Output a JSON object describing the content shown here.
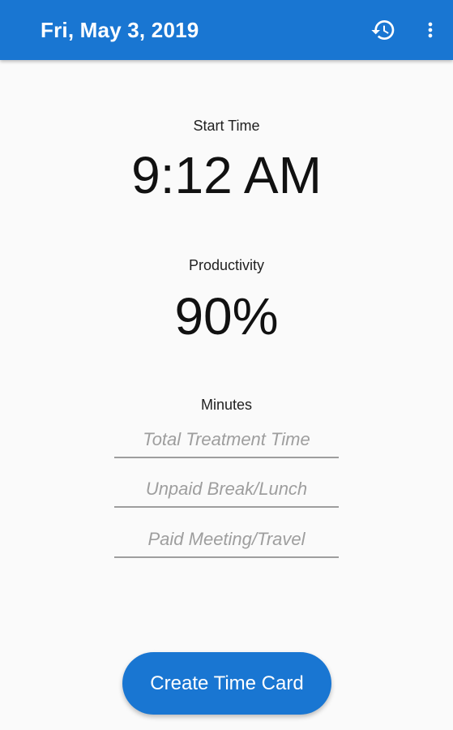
{
  "app_bar": {
    "title": "Fri, May 3, 2019",
    "actions": [
      {
        "icon": "history-icon"
      },
      {
        "icon": "more-vert-icon"
      }
    ],
    "color": "#1976d2"
  },
  "start_time": {
    "label": "Start Time",
    "value": "9:12 AM"
  },
  "productivity": {
    "label": "Productivity",
    "value": "90%"
  },
  "minutes": {
    "label": "Minutes",
    "fields": [
      {
        "placeholder": "Total Treatment Time",
        "value": ""
      },
      {
        "placeholder": "Unpaid Break/Lunch",
        "value": ""
      },
      {
        "placeholder": "Paid Meeting/Travel",
        "value": ""
      }
    ]
  },
  "create_button": {
    "label": "Create Time Card",
    "color": "#1976d2"
  }
}
